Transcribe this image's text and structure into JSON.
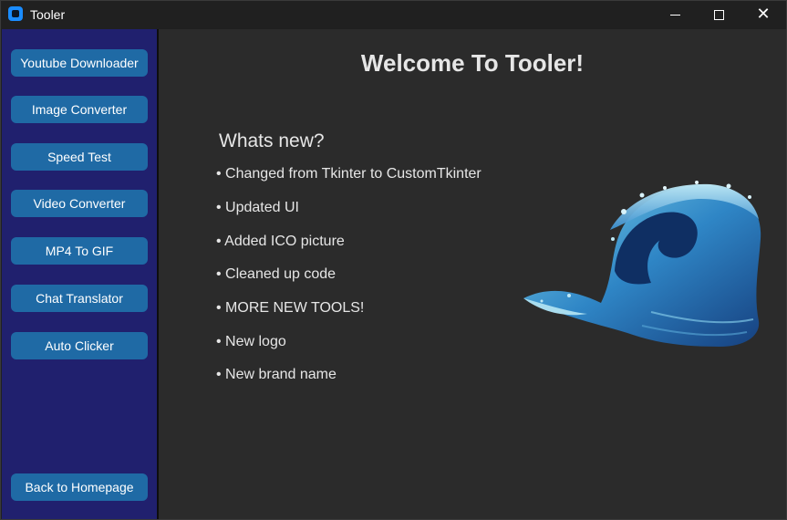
{
  "window": {
    "title": "Tooler",
    "minimize_glyph": "",
    "close_glyph": "✕"
  },
  "sidebar": {
    "items": [
      {
        "label": "Youtube Downloader"
      },
      {
        "label": "Image Converter"
      },
      {
        "label": "Speed Test"
      },
      {
        "label": "Video Converter"
      },
      {
        "label": "MP4 To GIF"
      },
      {
        "label": "Chat Translator"
      },
      {
        "label": "Auto Clicker"
      }
    ],
    "home_label": "Back to Homepage"
  },
  "main": {
    "welcome": "Welcome To Tooler!",
    "whats_new_title": "Whats new?",
    "bullets": [
      "• Changed from Tkinter to CustomTkinter",
      "• Updated UI",
      "• Added ICO picture",
      "• Cleaned up code",
      "• MORE NEW TOOLS!",
      "• New logo",
      "• New brand name"
    ]
  },
  "colors": {
    "sidebar_bg": "#20206e",
    "button_bg": "#1f6aa5",
    "main_bg": "#2b2b2b",
    "titlebar_bg": "#202020"
  },
  "icons": {
    "app": "app-icon",
    "image": "wave-icon"
  }
}
